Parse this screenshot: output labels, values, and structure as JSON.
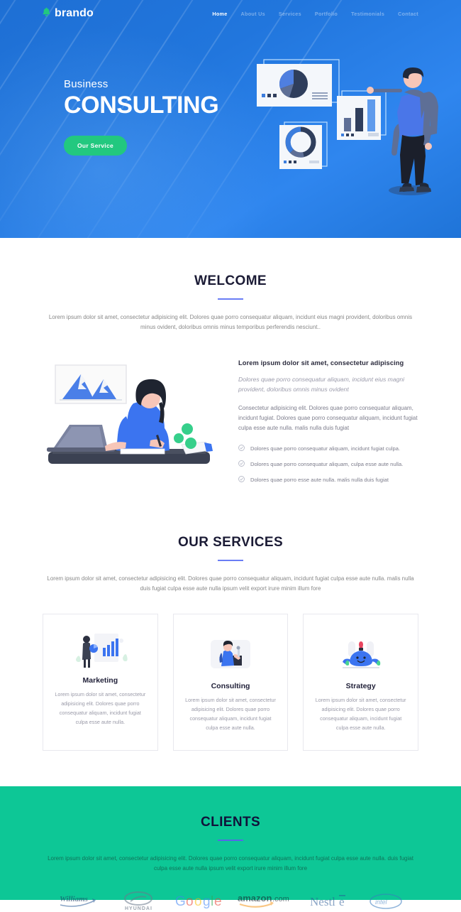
{
  "brand": {
    "name": "brando",
    "logo_icon": "bell-icon",
    "logo_color": "#22c87f"
  },
  "nav": {
    "items": [
      {
        "label": "Home",
        "active": true
      },
      {
        "label": "About Us",
        "active": false
      },
      {
        "label": "Services",
        "active": false
      },
      {
        "label": "Portfolio",
        "active": false
      },
      {
        "label": "Testimonials",
        "active": false
      },
      {
        "label": "Contact",
        "active": false
      }
    ]
  },
  "hero": {
    "subtitle": "Business",
    "title": "CONSULTING",
    "cta_label": "Our Service",
    "cta_color": "#22c87f",
    "bg_color": "#2176dd"
  },
  "welcome": {
    "title": "WELCOME",
    "description": "Lorem ipsum dolor sit amet, consectetur adipisicing elit. Dolores quae porro consequatur aliquam, incidunt eius magni provident, doloribus omnis minus ovident, doloribus omnis minus temporibus perferendis nesciunt..",
    "heading": "Lorem ipsum dolor sit amet, consectetur adipiscing",
    "italic": "Dolores quae porro consequatur aliquam, incidunt eius magni provident, doloribus omnis minus ovident",
    "body": "Consectetur adipisicing elit. Dolores quae porro consequatur aliquam, incidunt fugiat. Dolores quae porro consequatur aliquam, incidunt fugiat culpa esse aute nulla. malis nulla duis fugiat",
    "checklist": [
      "Dolores quae porro consequatur aliquam, incidunt fugiat culpa.",
      "Dolores quae porro consequatur aliquam, culpa esse aute nulla.",
      "Dolores quae porro esse aute nulla. malis nulla duis fugiat"
    ]
  },
  "services": {
    "title": "OUR SERVICES",
    "description": "Lorem ipsum dolor sit amet, consectetur adipisicing elit. Dolores quae porro consequatur aliquam, incidunt fugiat culpa esse aute nulla. malis nulla duis fugiat culpa esse aute nulla ipsum velit export irure minim illum fore",
    "cards": [
      {
        "title": "Marketing",
        "body": "Lorem ipsum dolor sit amet, consectetur adipisicing elit. Dolores quae porro consequatur aliquam, incidunt fugiat culpa esse aute nulla.",
        "icon": "marketing-chart-icon"
      },
      {
        "title": "Consulting",
        "body": "Lorem ipsum dolor sit amet, consectetur adipisicing elit. Dolores quae porro consequatur aliquam, incidunt fugiat culpa esse aute nulla.",
        "icon": "consulting-presenter-icon"
      },
      {
        "title": "Strategy",
        "body": "Lorem ipsum dolor sit amet, consectetur adipisicing elit. Dolores quae porro consequatur aliquam, incidunt fugiat culpa esse aute nulla.",
        "icon": "strategy-character-icon"
      }
    ]
  },
  "clients": {
    "title": "CLIENTS",
    "description": "Lorem ipsum dolor sit amet, consectetur adipisicing elit. Dolores quae porro consequatur aliquam, incidunt fugiat culpa esse aute nulla. duis fugiat culpa esse aute nulla ipsum velit export irure minim illum fore",
    "bg_color": "#0dc796",
    "logos": [
      {
        "name": "Williams"
      },
      {
        "name": "HYUNDAI"
      },
      {
        "name": "Google"
      },
      {
        "name": "amazon.com"
      },
      {
        "name": "Nestle"
      },
      {
        "name": "intel"
      }
    ]
  }
}
